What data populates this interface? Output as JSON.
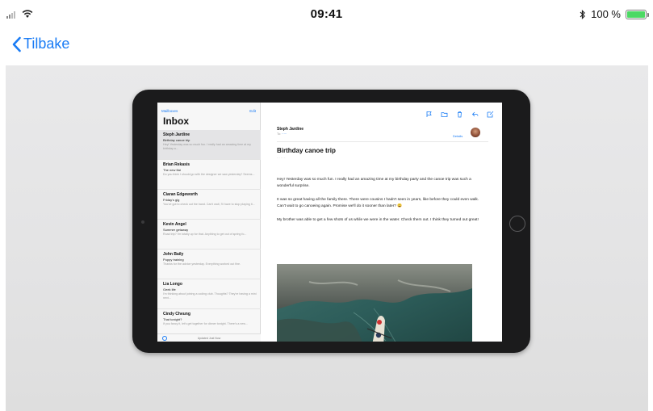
{
  "status_bar": {
    "time": "09:41",
    "battery_text": "100 %",
    "battery_level": 1.0
  },
  "nav": {
    "back_label": "Tilbake"
  },
  "device_screen": {
    "mail_list": {
      "back_label": "Mailboxes",
      "edit_label": "Edit",
      "title": "Inbox",
      "messages": [
        {
          "sender": "Steph Jardine",
          "subject": "Birthday canoe trip",
          "preview": "Hey! Yesterday was so much fun. I really had an amazing time at my birthday a...",
          "selected": true
        },
        {
          "sender": "Brian Rekasis",
          "subject": "The new flat",
          "preview": "Do you think I should go with the designer we saw yesterday? Seems..."
        },
        {
          "sender": "Ciaran Edgeworth",
          "subject": "Friday's gig",
          "preview": "You've got to check out the band. Can't wait, I'll have to stop playing it..."
        },
        {
          "sender": "Kevin Angel",
          "subject": "Summer getaway",
          "preview": "Road trip? I'm totally up for that. Anything to get out of spring fo..."
        },
        {
          "sender": "John Baily",
          "subject": "Puppy training",
          "preview": "Thanks for the advice yesterday. Everything worked out fine."
        },
        {
          "sender": "Lia Longo",
          "subject": "Geek life",
          "preview": "I'm thinking about joining a coding club. Thoughts? They're having a mini next..."
        },
        {
          "sender": "Cindy Cheung",
          "subject": "That tonight?",
          "preview": "If you fancy it, let's get together for dinner tonight. There's a new..."
        }
      ],
      "footer_text": "Updated Just Now"
    },
    "message": {
      "from": "Steph Jardine",
      "subject": "Birthday canoe trip",
      "details_label": "Details",
      "body": [
        "Hey! Yesterday was so much fun. I really had an amazing time at my birthday party and the canoe trip was such a wonderful surprise.",
        "It was so great having all the family there. There were cousins I hadn't seen in years, like before they could even walk. Can't wait to go canoeing again. Promise we'll do it sooner than later? 😀",
        "My brother was able to get a few shots of us while we were in the water. Check them out. I think they turned out great!"
      ]
    }
  },
  "colors": {
    "accent": "#1a7cf5",
    "battery": "#4cd964",
    "device_bezel": "#1b1b1c",
    "backdrop": "#e6e6e7"
  },
  "icons": [
    "signal-icon",
    "wifi-icon",
    "bluetooth-icon",
    "battery-icon",
    "chevron-left-icon",
    "flag-icon",
    "folder-icon",
    "trash-icon",
    "reply-icon",
    "compose-icon"
  ]
}
